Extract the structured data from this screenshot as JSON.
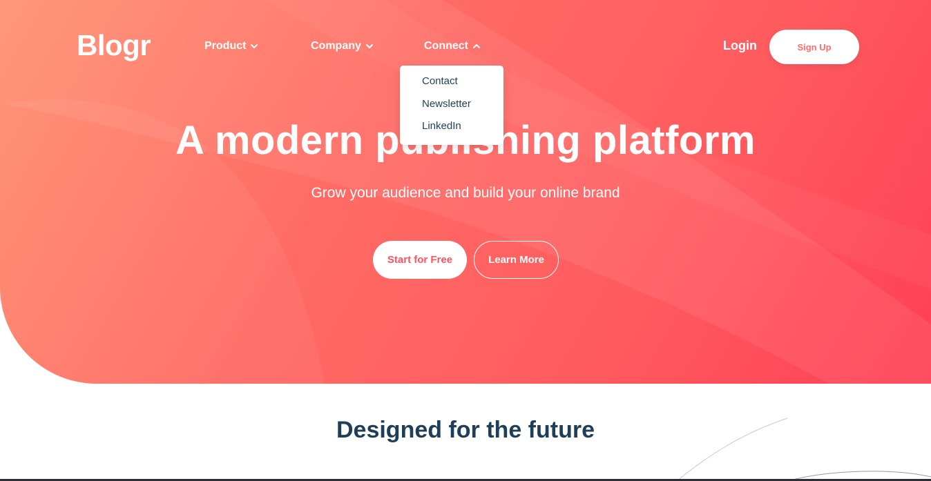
{
  "brand": {
    "logo": "Blogr"
  },
  "nav": {
    "items": [
      {
        "label": "Product",
        "icon": "chevron-down-icon"
      },
      {
        "label": "Company",
        "icon": "chevron-down-icon"
      },
      {
        "label": "Connect",
        "icon": "chevron-up-icon"
      }
    ],
    "dropdown": {
      "items": [
        "Contact",
        "Newsletter",
        "LinkedIn"
      ]
    },
    "login_label": "Login",
    "signup_label": "Sign Up"
  },
  "hero": {
    "title": "A modern publishing platform",
    "subtitle": "Grow your audience and build your online brand",
    "primary_cta": "Start for Free",
    "secondary_cta": "Learn More"
  },
  "features": {
    "title": "Designed for the future"
  },
  "colors": {
    "gradient_start": "#ff8f70",
    "gradient_end": "#ff3f55",
    "heading_dark": "#1f3e5a",
    "accent": "#ff525d"
  }
}
